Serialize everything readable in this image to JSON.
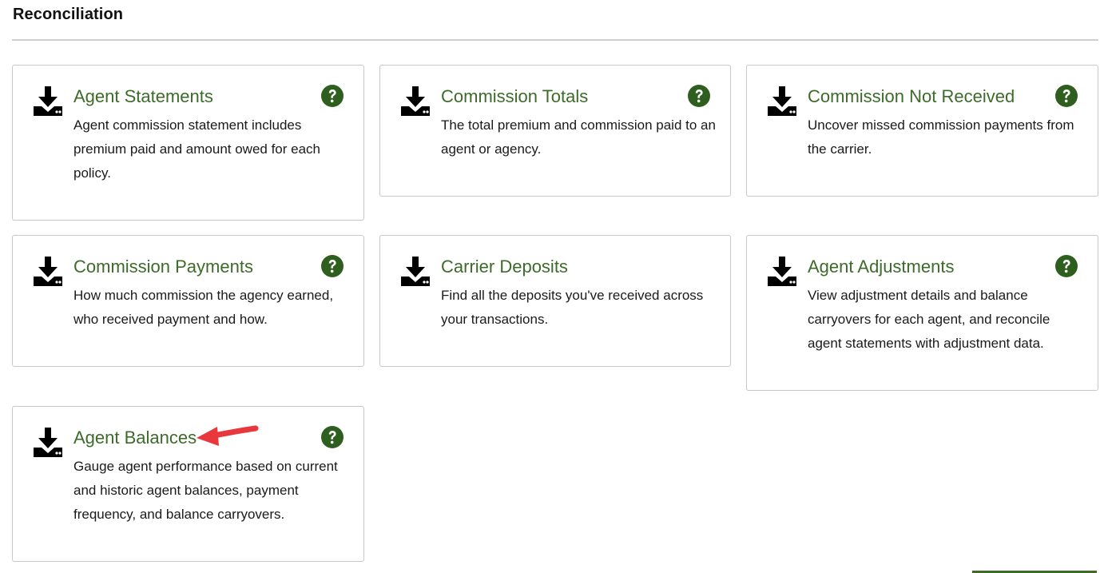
{
  "section": {
    "title": "Reconciliation"
  },
  "cards": [
    {
      "title": "Agent Statements",
      "description": "Agent commission statement includes premium paid and amount owed for each policy.",
      "icon": "download-tray-icon",
      "help_icon": "question-circle-icon"
    },
    {
      "title": "Commission Totals",
      "description": "The total premium and commission paid to an agent or agency.",
      "icon": "download-tray-icon",
      "help_icon": "question-circle-icon"
    },
    {
      "title": "Commission Not Received",
      "description": "Uncover missed commission payments from the carrier.",
      "icon": "download-tray-icon",
      "help_icon": "question-circle-icon"
    },
    {
      "title": "Commission Payments",
      "description": "How much commission the agency earned, who received payment and how.",
      "icon": "download-tray-icon",
      "help_icon": "question-circle-icon"
    },
    {
      "title": "Carrier Deposits",
      "description": "Find all the deposits you've received across your transactions.",
      "icon": "download-tray-icon",
      "help_icon": "question-circle-icon"
    },
    {
      "title": "Agent Adjustments",
      "description": "View adjustment details and balance carryovers for each agent, and reconcile agent statements with adjustment data.",
      "icon": "download-tray-icon",
      "help_icon": "question-circle-icon"
    },
    {
      "title": "Agent Balances",
      "description": "Gauge agent performance based on current and historic agent balances, payment frequency, and balance carryovers.",
      "icon": "download-tray-icon",
      "help_icon": "question-circle-icon"
    }
  ],
  "colors": {
    "title_green": "#3d6b2a",
    "help_green": "#2f5f1f",
    "annotation_arrow": "#e8383d",
    "border": "#c8c8c8"
  }
}
